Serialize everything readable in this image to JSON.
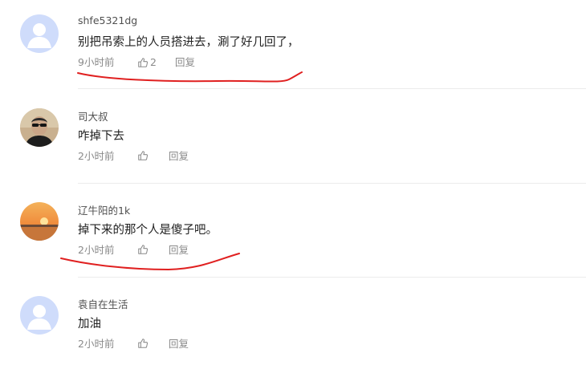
{
  "comments": [
    {
      "username": "shfe5321dg",
      "text": "别把吊索上的人员搭进去，涮了好几回了，",
      "time": "9小时前",
      "likes": "2",
      "reply": "回复",
      "avatar": "default-avatar-icon"
    },
    {
      "username": "司大叔",
      "text": "咋掉下去",
      "time": "2小时前",
      "likes": "",
      "reply": "回复",
      "avatar": "man-photo-avatar"
    },
    {
      "username": "辽牛阳的1k",
      "text": "掉下来的那个人是傻子吧。",
      "time": "2小时前",
      "likes": "",
      "reply": "回复",
      "avatar": "sunset-photo-avatar"
    },
    {
      "username": "袁自在生活",
      "text": "加油",
      "time": "2小时前",
      "likes": "",
      "reply": "回复",
      "avatar": "default-avatar-icon"
    }
  ],
  "colors": {
    "annotation": "#e02020",
    "default_avatar_bg": "#cfdcfb",
    "default_avatar_fg": "#ffffff"
  }
}
